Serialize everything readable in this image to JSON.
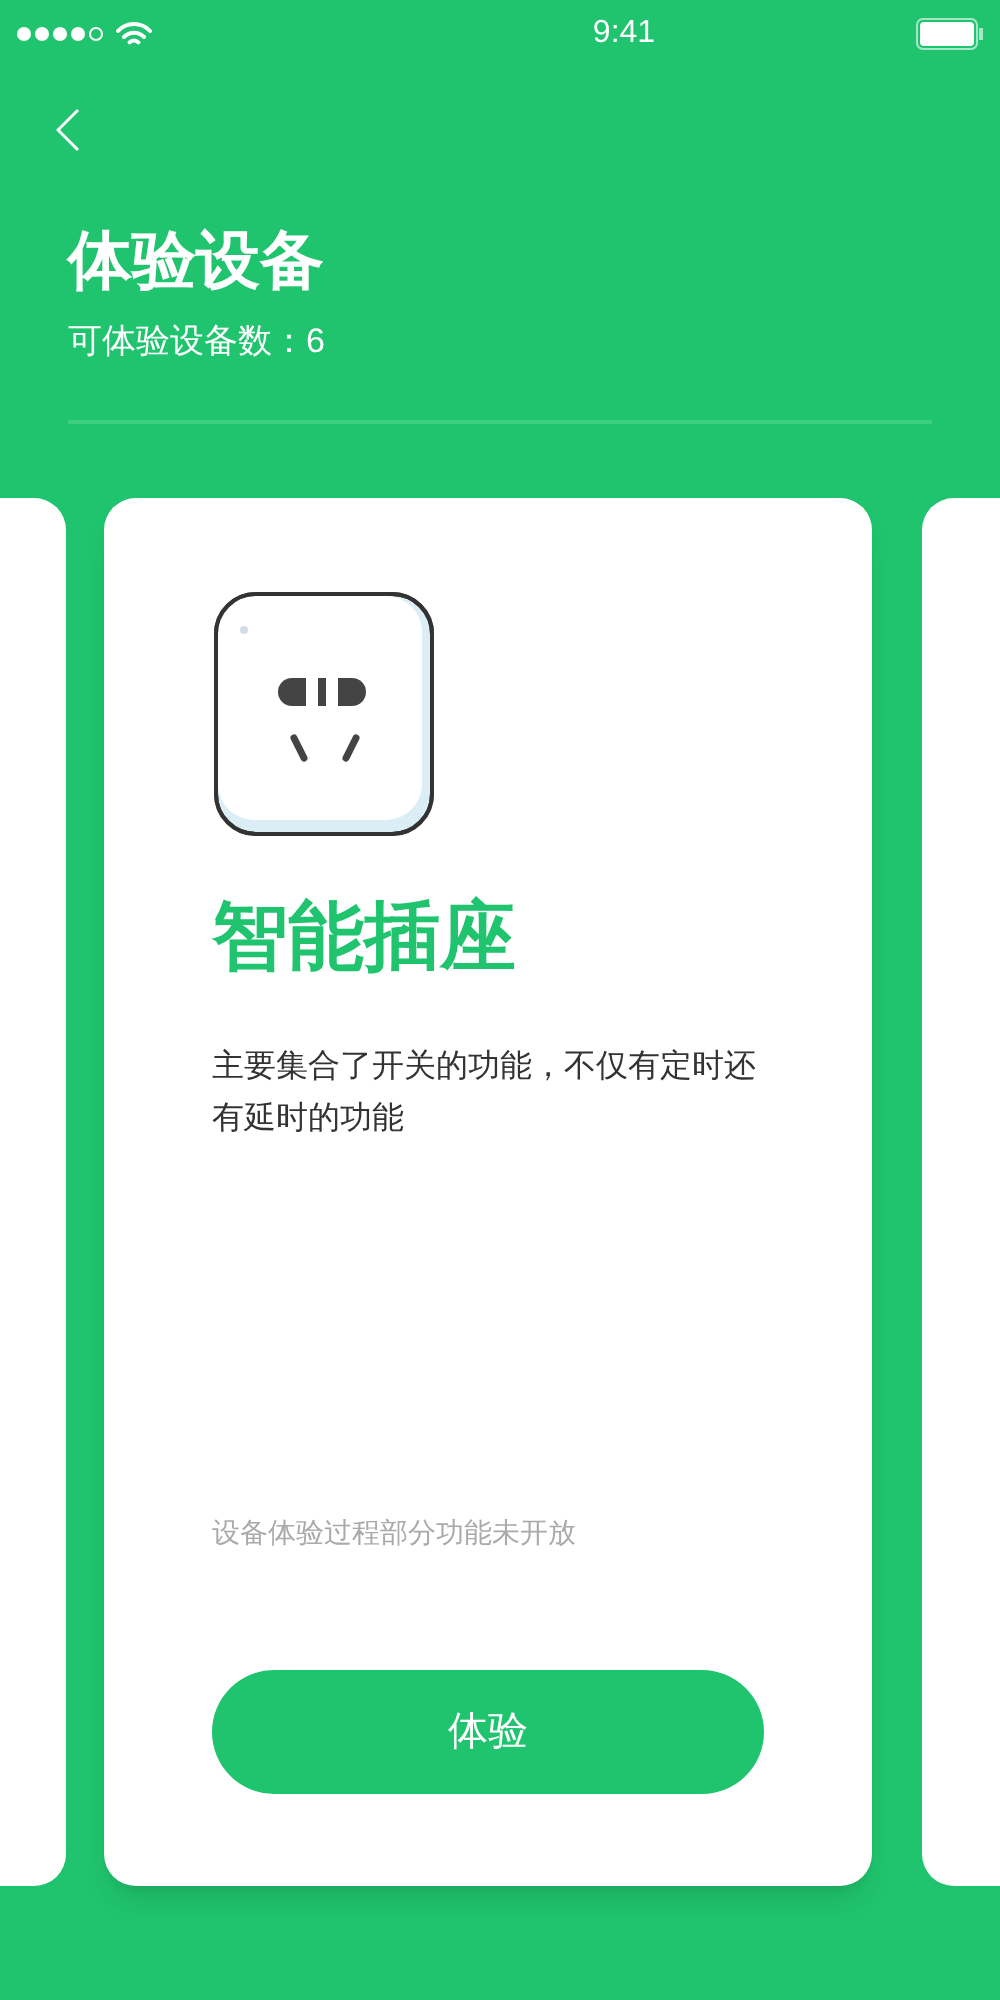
{
  "status_bar": {
    "time": "9:41"
  },
  "header": {
    "title": "体验设备",
    "subtitle": "可体验设备数：6"
  },
  "card": {
    "name": "智能插座",
    "description": "主要集合了开关的功能，不仅有定时还有延时的功能",
    "note": "设备体验过程部分功能未开放",
    "button": "体验"
  }
}
